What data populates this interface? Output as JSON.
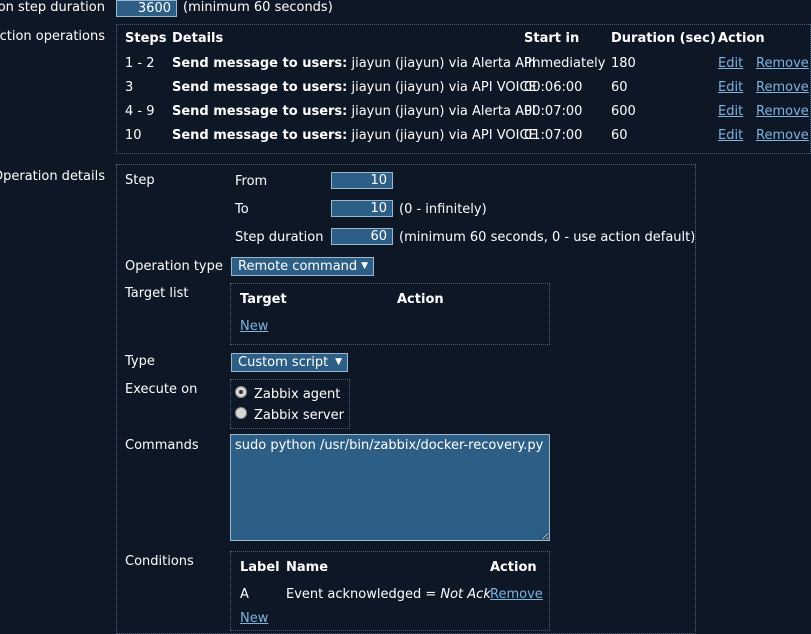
{
  "step_duration": {
    "label": "on step duration",
    "value": "3600",
    "hint": "(minimum 60 seconds)"
  },
  "action_operations": {
    "label": "Action operations",
    "headers": {
      "steps": "Steps",
      "details": "Details",
      "start_in": "Start in",
      "duration": "Duration (sec)",
      "action": "Action"
    },
    "rows": [
      {
        "steps": "1 - 2",
        "details_bold": "Send message to users:",
        "details_rest": " jiayun (jiayun) via Alerta API",
        "start_in": "Immediately",
        "duration": "180",
        "edit": "Edit",
        "remove": "Remove"
      },
      {
        "steps": "3",
        "details_bold": "Send message to users:",
        "details_rest": " jiayun (jiayun) via API VOICE",
        "start_in": "00:06:00",
        "duration": "60",
        "edit": "Edit",
        "remove": "Remove"
      },
      {
        "steps": "4 - 9",
        "details_bold": "Send message to users:",
        "details_rest": " jiayun (jiayun) via Alerta API",
        "start_in": "00:07:00",
        "duration": "600",
        "edit": "Edit",
        "remove": "Remove"
      },
      {
        "steps": "10",
        "details_bold": "Send message to users:",
        "details_rest": " jiayun (jiayun) via API VOICE",
        "start_in": "01:07:00",
        "duration": "60",
        "edit": "Edit",
        "remove": "Remove"
      }
    ]
  },
  "operation_details": {
    "label": "Operation details",
    "step": {
      "label": "Step",
      "from_label": "From",
      "from_value": "10",
      "to_label": "To",
      "to_value": "10",
      "to_hint": "(0 - infinitely)",
      "duration_label": "Step duration",
      "duration_value": "60",
      "duration_hint": "(minimum 60 seconds, 0 - use action default)"
    },
    "operation_type": {
      "label": "Operation type",
      "value": "Remote command"
    },
    "target_list": {
      "label": "Target list",
      "col_target": "Target",
      "col_action": "Action",
      "new_link": "New"
    },
    "type": {
      "label": "Type",
      "value": "Custom script"
    },
    "execute_on": {
      "label": "Execute on",
      "options": [
        "Zabbix agent",
        "Zabbix server"
      ],
      "selected": "Zabbix agent"
    },
    "commands": {
      "label": "Commands",
      "value": "sudo python /usr/bin/zabbix/docker-recovery.py"
    },
    "conditions": {
      "label": "Conditions",
      "col_label": "Label",
      "col_name": "Name",
      "col_action": "Action",
      "rows": [
        {
          "label": "A",
          "name": "Event acknowledged = ",
          "name_italic": "Not Ack",
          "remove": "Remove"
        }
      ],
      "new_link": "New"
    }
  },
  "colors": {
    "background": "#0e1726",
    "link": "#7fb3e0",
    "input_bg": "#2d5f86",
    "input_border": "#9bb8d0"
  }
}
